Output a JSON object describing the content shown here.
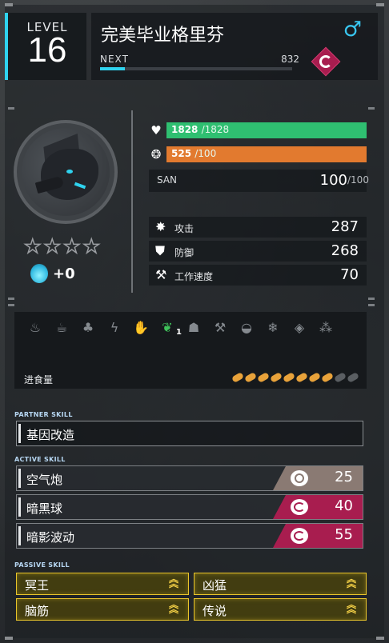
{
  "header": {
    "level_label": "LEVEL",
    "level": "16",
    "name": "完美毕业格里芬",
    "gender_icon": "male-icon",
    "next_label": "NEXT",
    "next_value": "832",
    "xp_progress": 0.13,
    "element_icon": "dark-element-icon",
    "element_color": "#a81d4f"
  },
  "portrait": {
    "rarity_stars": 4,
    "stars_filled": 0,
    "condense_value": "+0"
  },
  "stats": {
    "hp": {
      "value": "1828",
      "max": "/1828",
      "fraction": 1.0,
      "color": "#2fbf71",
      "icon": "heart-icon"
    },
    "food": {
      "value": "525",
      "max": "/100",
      "fraction": 1.0,
      "color": "#e27a2f",
      "icon": "food-icon"
    },
    "san": {
      "label": "SAN",
      "value": "100",
      "max": "/100"
    },
    "attack": {
      "label": "攻击",
      "value": "287",
      "icon": "attack-icon"
    },
    "defense": {
      "label": "防御",
      "value": "268",
      "icon": "shield-icon"
    },
    "work_speed": {
      "label": "工作速度",
      "value": "70",
      "icon": "hammer-icon"
    }
  },
  "work": {
    "icons": [
      {
        "name": "kindling-icon",
        "glyph": "♨",
        "active": false
      },
      {
        "name": "watering-icon",
        "glyph": "☕",
        "active": false
      },
      {
        "name": "planting-icon",
        "glyph": "♣",
        "active": false
      },
      {
        "name": "electricity-icon",
        "glyph": "ϟ",
        "active": false
      },
      {
        "name": "handiwork-icon",
        "glyph": "✋",
        "active": false
      },
      {
        "name": "gathering-icon",
        "glyph": "❦",
        "active": true,
        "level": "1"
      },
      {
        "name": "lumbering-icon",
        "glyph": "☗",
        "active": false
      },
      {
        "name": "mining-icon",
        "glyph": "⚒",
        "active": false
      },
      {
        "name": "medicine-icon",
        "glyph": "◒",
        "active": false
      },
      {
        "name": "cooling-icon",
        "glyph": "❄",
        "active": false
      },
      {
        "name": "transporting-icon",
        "glyph": "◈",
        "active": false
      },
      {
        "name": "farming-icon",
        "glyph": "⁂",
        "active": false
      }
    ],
    "food_label": "进食量",
    "food_total": 10,
    "food_filled": 8,
    "food_color": "#e8a23a",
    "food_empty_color": "#5a5e62"
  },
  "skills": {
    "partner_title": "PARTNER SKILL",
    "partner": "基因改造",
    "active_title": "ACTIVE SKILL",
    "active": [
      {
        "name": "空气炮",
        "power": "25",
        "element": "neutral",
        "color": "#8a7a73"
      },
      {
        "name": "暗黑球",
        "power": "40",
        "element": "dark",
        "color": "#a81d4f"
      },
      {
        "name": "暗影波动",
        "power": "55",
        "element": "dark",
        "color": "#a81d4f"
      }
    ],
    "passive_title": "PASSIVE SKILL",
    "passive": [
      {
        "name": "冥王"
      },
      {
        "name": "凶猛"
      },
      {
        "name": "脑筋"
      },
      {
        "name": "传说"
      }
    ]
  }
}
